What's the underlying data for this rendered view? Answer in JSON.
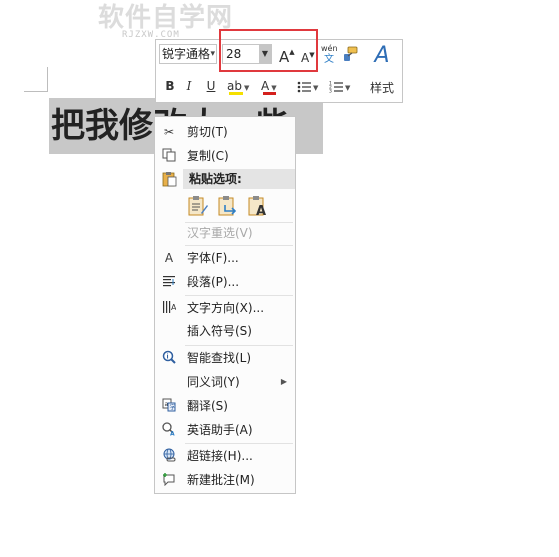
{
  "watermark": {
    "title": "软件自学网",
    "url": "RJZXW.COM"
  },
  "document": {
    "text": "把我修改太一些"
  },
  "mini_toolbar": {
    "font_name": "锐字通格",
    "font_size": "28",
    "grow_font_label": "A",
    "shrink_font_label": "A",
    "phonetic_top": "wén",
    "phonetic_bottom": "文",
    "styles_label": "样式",
    "bold_label": "B",
    "italic_label": "I",
    "underline_label": "U",
    "highlight_label": "ab",
    "font_color_label": "A",
    "colors": {
      "highlight": "#f5e000",
      "font_color": "#d4201c",
      "annotation_box": "#e0393e"
    }
  },
  "context_menu": {
    "cut": "剪切(T)",
    "copy": "复制(C)",
    "paste_options_header": "粘贴选项:",
    "reconvert": "汉字重选(V)",
    "font": "字体(F)...",
    "paragraph": "段落(P)...",
    "text_direction": "文字方向(X)...",
    "insert_symbol": "插入符号(S)",
    "smart_lookup": "智能查找(L)",
    "synonyms": "同义词(Y)",
    "translate": "翻译(S)",
    "english_assistant": "英语助手(A)",
    "hyperlink": "超链接(H)...",
    "new_comment": "新建批注(M)"
  }
}
